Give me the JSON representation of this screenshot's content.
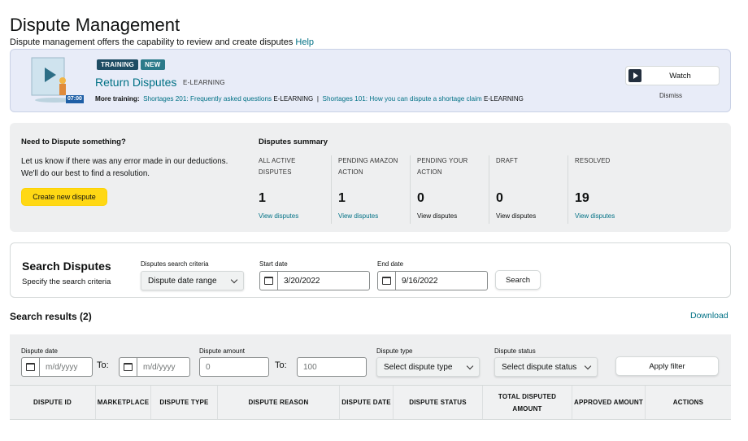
{
  "header": {
    "title": "Dispute Management",
    "subtitle": "Dispute management offers the capability to review and create disputes",
    "help_link": "Help"
  },
  "training": {
    "badges": [
      "TRAINING",
      "NEW"
    ],
    "title": "Return Disputes",
    "type": "E-LEARNING",
    "duration": "07:00",
    "more_label": "More training:",
    "more_items": [
      {
        "title": "Shortages 201: Frequently asked questions",
        "type": "E-LEARNING"
      },
      {
        "title": "Shortages 101: How you can dispute a shortage claim",
        "type": "E-LEARNING"
      }
    ],
    "separator": "|",
    "watch_label": "Watch",
    "dismiss_label": "Dismiss"
  },
  "need": {
    "title": "Need to Dispute something?",
    "text": "Let us know if there was any error made in our deductions. We'll do our best to find a resolution.",
    "create_button": "Create new dispute"
  },
  "summary": {
    "title": "Disputes summary",
    "columns": [
      {
        "label": "ALL ACTIVE DISPUTES",
        "count": "1",
        "link": "View disputes",
        "linked": true
      },
      {
        "label": "PENDING AMAZON ACTION",
        "count": "1",
        "link": "View disputes",
        "linked": true
      },
      {
        "label": "PENDING YOUR ACTION",
        "count": "0",
        "link": "View disputes",
        "linked": false
      },
      {
        "label": "DRAFT",
        "count": "0",
        "link": "View disputes",
        "linked": false
      },
      {
        "label": "RESOLVED",
        "count": "19",
        "link": "View disputes",
        "linked": true
      }
    ]
  },
  "search": {
    "title": "Search Disputes",
    "subtitle": "Specify the search criteria",
    "criteria_label": "Disputes search criteria",
    "criteria_value": "Dispute date range",
    "start_label": "Start date",
    "start_value": "3/20/2022",
    "end_label": "End date",
    "end_value": "9/16/2022",
    "search_button": "Search"
  },
  "results": {
    "title": "Search results (2)",
    "download": "Download"
  },
  "filters": {
    "date_label": "Dispute date",
    "date_from_placeholder": "m/d/yyyy",
    "date_to_placeholder": "m/d/yyyy",
    "to_label": "To:",
    "amount_label": "Dispute amount",
    "amount_from": "0",
    "amount_to": "100",
    "type_label": "Dispute type",
    "type_value": "Select dispute type",
    "status_label": "Dispute status",
    "status_value": "Select dispute status",
    "apply_button": "Apply filter"
  },
  "table": {
    "columns": [
      "DISPUTE ID",
      "MARKETPLACE",
      "DISPUTE TYPE",
      "DISPUTE REASON",
      "DISPUTE DATE",
      "DISPUTE STATUS",
      "TOTAL DISPUTED AMOUNT",
      "APPROVED AMOUNT",
      "ACTIONS"
    ]
  }
}
